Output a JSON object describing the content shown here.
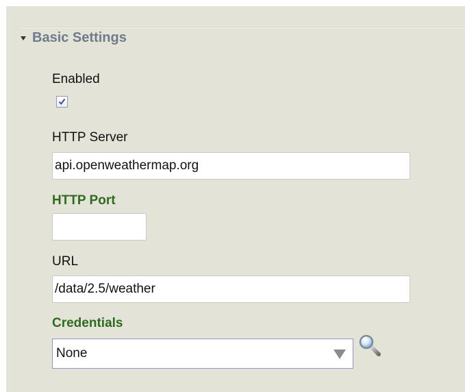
{
  "section": {
    "title": "Basic Settings",
    "expanded": true
  },
  "fields": {
    "enabled": {
      "label": "Enabled",
      "checked": true
    },
    "http_server": {
      "label": "HTTP Server",
      "value": "api.openweathermap.org"
    },
    "http_port": {
      "label": "HTTP Port",
      "value": ""
    },
    "url": {
      "label": "URL",
      "value": "/data/2.5/weather"
    },
    "credentials": {
      "label": "Credentials",
      "selected": "None"
    }
  },
  "icons": {
    "section_toggle": "caret-down-icon",
    "checkbox_mark": "checkmark-icon",
    "select_arrow": "triangle-down-icon",
    "lookup": "magnifier-icon"
  },
  "colors": {
    "panel_background": "#e3e3d7",
    "section_title": "#6e7b8b",
    "required_label": "#2f6b1e",
    "checkmark": "#3b4fa0",
    "select_border": "#9a90cf"
  }
}
